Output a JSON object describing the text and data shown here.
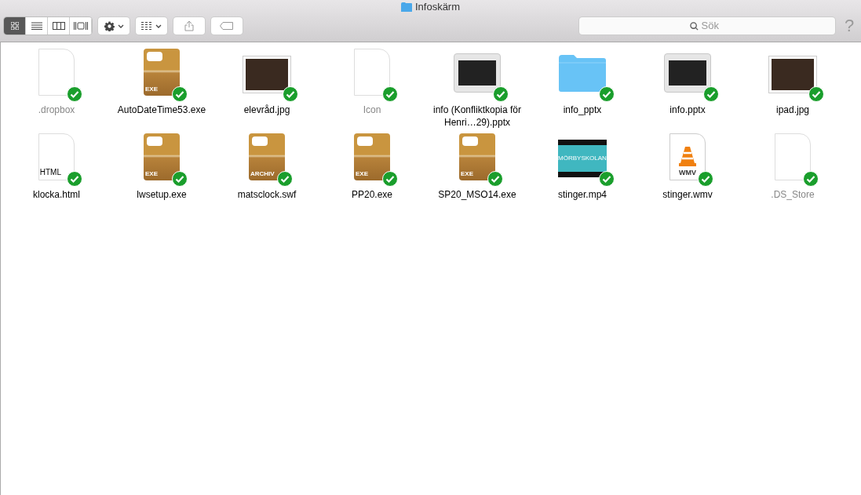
{
  "window": {
    "title": "Infoskärm"
  },
  "toolbar": {
    "views": [
      {
        "kind": "icons",
        "selected": true
      },
      {
        "kind": "list",
        "selected": false
      },
      {
        "kind": "columns",
        "selected": false
      },
      {
        "kind": "coverflow",
        "selected": false
      }
    ],
    "search": {
      "placeholder": "Sök"
    },
    "help": "?"
  },
  "files": [
    {
      "name": ".dropbox",
      "kind": "blank",
      "hidden": true,
      "synced": true
    },
    {
      "name": "AutoDateTime53.exe",
      "kind": "archive",
      "badge": "EXE",
      "hidden": false,
      "synced": true
    },
    {
      "name": "elevråd.jpg",
      "kind": "photo",
      "hidden": false,
      "synced": true
    },
    {
      "name": "Icon",
      "kind": "blank",
      "hidden": true,
      "synced": true
    },
    {
      "name": "info (Konfliktkopia för Henri…29).pptx",
      "kind": "slides",
      "hidden": false,
      "synced": true
    },
    {
      "name": "info_pptx",
      "kind": "folder",
      "hidden": false,
      "synced": true
    },
    {
      "name": "info.pptx",
      "kind": "slides",
      "hidden": false,
      "synced": true
    },
    {
      "name": "ipad.jpg",
      "kind": "photo",
      "hidden": false,
      "synced": true
    },
    {
      "name": "klocka.html",
      "kind": "blank",
      "badge": "HTML",
      "hidden": false,
      "synced": true
    },
    {
      "name": "lwsetup.exe",
      "kind": "archive",
      "badge": "EXE",
      "hidden": false,
      "synced": true
    },
    {
      "name": "matsclock.swf",
      "kind": "archive",
      "badge": "ARCHIV",
      "hidden": false,
      "synced": true
    },
    {
      "name": "PP20.exe",
      "kind": "archive",
      "badge": "EXE",
      "hidden": false,
      "synced": true
    },
    {
      "name": "SP20_MSO14.exe",
      "kind": "archive",
      "badge": "EXE",
      "hidden": false,
      "synced": true
    },
    {
      "name": "stinger.mp4",
      "kind": "video",
      "badge": "MÖRBYSKOLAN",
      "hidden": false,
      "synced": true
    },
    {
      "name": "stinger.wmv",
      "kind": "vlc",
      "badge": "WMV",
      "hidden": false,
      "synced": true
    },
    {
      "name": ".DS_Store",
      "kind": "blank",
      "hidden": true,
      "synced": true
    }
  ]
}
